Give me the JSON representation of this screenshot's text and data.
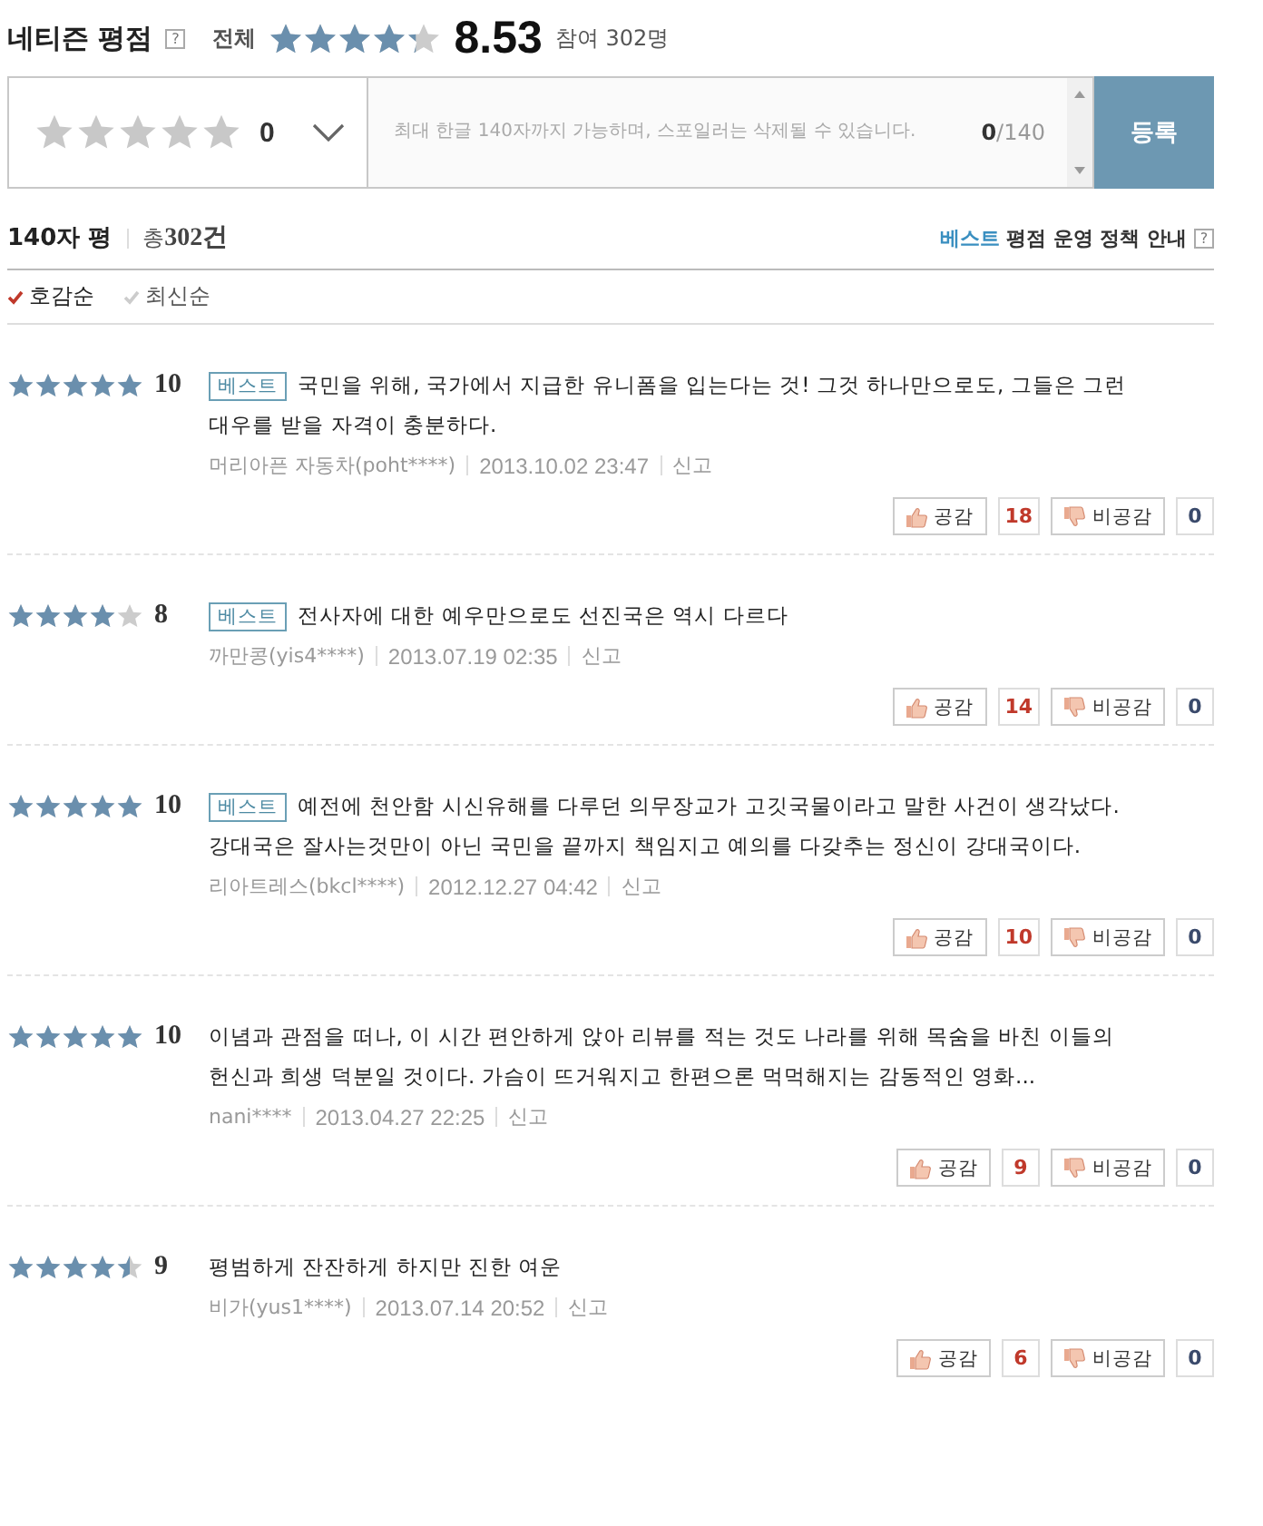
{
  "header": {
    "title": "네티즌 평점",
    "help": "?",
    "overall_label": "전체",
    "stars": 4.27,
    "score": "8.53",
    "participants": "참여 302명"
  },
  "input": {
    "stars": 0,
    "score": "0",
    "placeholder": "최대 한글 140자까지 가능하며, 스포일러는 삭제될 수 있습니다.",
    "count": "0",
    "max": "/140",
    "submit": "등록"
  },
  "list_header": {
    "title": "140자 평",
    "total_prefix": "총",
    "total": "302건",
    "policy_best": "베스트",
    "policy": "평점 운영 정책 안내",
    "help": "?"
  },
  "sort": [
    {
      "label": "호감순",
      "selected": true
    },
    {
      "label": "최신순",
      "selected": false
    }
  ],
  "reviews": [
    {
      "stars": 5,
      "score": "10",
      "badge": "베스트",
      "text": "국민을 위해, 국가에서 지급한 유니폼을 입는다는 것! 그것 하나만으로도, 그들은 그런 대우를 받을 자격이 충분하다.",
      "author": "머리아픈 자동차(poht****)",
      "date": "2013.10.02 23:47",
      "report": "신고",
      "like_label": "공감",
      "likes": "18",
      "dislike_label": "비공감",
      "dislikes": "0"
    },
    {
      "stars": 4,
      "score": "8",
      "badge": "베스트",
      "text": "전사자에 대한 예우만으로도 선진국은 역시 다르다",
      "author": "까만콩(yis4****)",
      "date": "2013.07.19 02:35",
      "report": "신고",
      "like_label": "공감",
      "likes": "14",
      "dislike_label": "비공감",
      "dislikes": "0"
    },
    {
      "stars": 5,
      "score": "10",
      "badge": "베스트",
      "text": "예전에 천안함 시신유해를 다루던 의무장교가 고깃국물이라고 말한 사건이 생각났다. 강대국은 잘사는것만이 아닌 국민을 끝까지 책임지고 예의를 다갖추는 정신이 강대국이다.",
      "author": "리아트레스(bkcl****)",
      "date": "2012.12.27 04:42",
      "report": "신고",
      "like_label": "공감",
      "likes": "10",
      "dislike_label": "비공감",
      "dislikes": "0"
    },
    {
      "stars": 5,
      "score": "10",
      "text": "이념과 관점을 떠나, 이 시간 편안하게 앉아 리뷰를 적는 것도 나라를 위해 목숨을 바친 이들의 헌신과 희생 덕분일 것이다. 가슴이 뜨거워지고 한편으론 먹먹해지는 감동적인 영화...",
      "author": "nani****",
      "date": "2013.04.27 22:25",
      "report": "신고",
      "like_label": "공감",
      "likes": "9",
      "dislike_label": "비공감",
      "dislikes": "0"
    },
    {
      "stars": 4.5,
      "score": "9",
      "text": "평범하게 잔잔하게 하지만 진한 여운",
      "author": "비가(yus1****)",
      "date": "2013.07.14 20:52",
      "report": "신고",
      "like_label": "공감",
      "likes": "6",
      "dislike_label": "비공감",
      "dislikes": "0"
    }
  ]
}
